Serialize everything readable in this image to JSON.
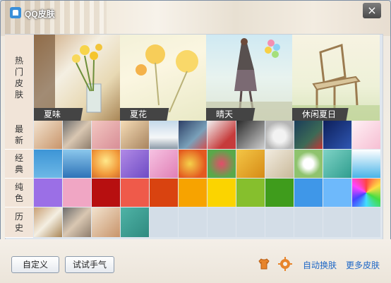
{
  "window": {
    "title": "QQ皮肤",
    "close_glyph": "×"
  },
  "rows": {
    "hot": "热门皮肤",
    "latest": "最新",
    "classic": "经典",
    "solid": "纯色",
    "history": "历史"
  },
  "hot_skins": [
    "夏味",
    "夏花",
    "晴天",
    "休闲夏日"
  ],
  "solid_colors": [
    "#9b6fe6",
    "#f0a6c4",
    "#b70f10",
    "#ef5a4a",
    "#d94310",
    "#f7a300",
    "#fbd400",
    "#86bf2d",
    "#3f9c1c",
    "#3f97e8",
    "#6eb9fb",
    "#rainbow"
  ],
  "footer": {
    "custom_button": "自定义",
    "try_button": "试试手气",
    "auto_change_link": "自动换肤",
    "more_skins_link": "更多皮肤"
  }
}
